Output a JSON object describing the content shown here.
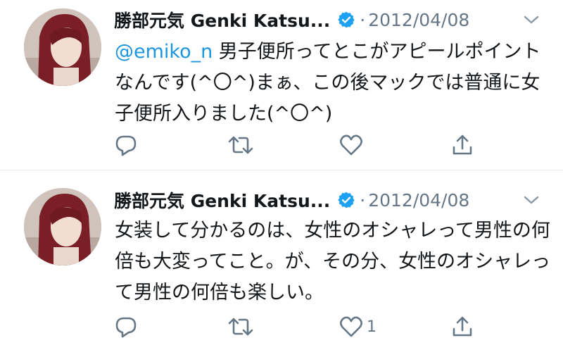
{
  "colors": {
    "link": "#1b95e0",
    "verified": "#1da1f2",
    "secondary": "#657786"
  },
  "tweets": [
    {
      "name": "勝部元気 Genki Katsu...",
      "verified_icon": "verified-badge-icon",
      "separator": "·",
      "date": "2012/04/08",
      "mention": "@emiko_n",
      "text": " 男子便所ってとこがアピールポイントなんです(^〇^)まぁ、この後マックでは普通に女子便所入りました(^〇^)",
      "like_count": ""
    },
    {
      "name": "勝部元気 Genki Katsu...",
      "verified_icon": "verified-badge-icon",
      "separator": "·",
      "date": "2012/04/08",
      "mention": "",
      "text": "女装して分かるのは、女性のオシャレって男性の何倍も大変ってこと。が、その分、女性のオシャレって男性の何倍も楽しい。",
      "like_count": "1"
    }
  ]
}
